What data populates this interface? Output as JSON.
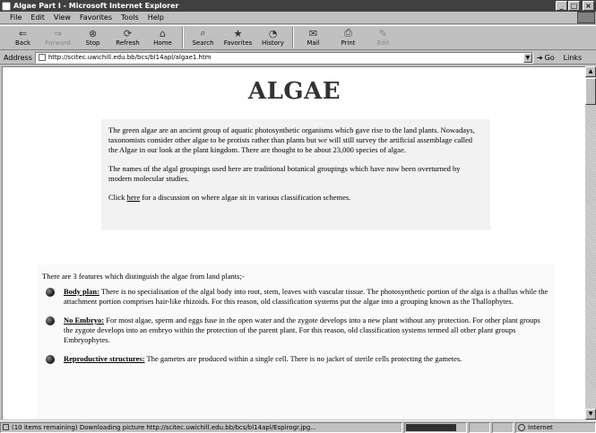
{
  "window": {
    "title": "Algae Part I - Microsoft Internet Explorer",
    "minimize": "_",
    "maximize": "□",
    "close": "×"
  },
  "menu": [
    "File",
    "Edit",
    "View",
    "Favorites",
    "Tools",
    "Help"
  ],
  "toolbar": [
    {
      "label": "Back",
      "icon": "back-arrow-icon",
      "glyph": "⇐"
    },
    {
      "label": "Forward",
      "icon": "forward-arrow-icon",
      "glyph": "⇒"
    },
    {
      "label": "Stop",
      "icon": "stop-icon",
      "glyph": "⊗"
    },
    {
      "label": "Refresh",
      "icon": "refresh-icon",
      "glyph": "⟳"
    },
    {
      "label": "Home",
      "icon": "home-icon",
      "glyph": "⌂"
    },
    {
      "label": "Search",
      "icon": "search-icon",
      "glyph": "⌕"
    },
    {
      "label": "Favorites",
      "icon": "favorites-icon",
      "glyph": "★"
    },
    {
      "label": "History",
      "icon": "history-icon",
      "glyph": "◔"
    },
    {
      "label": "Mail",
      "icon": "mail-icon",
      "glyph": "✉"
    },
    {
      "label": "Print",
      "icon": "print-icon",
      "glyph": "⎙"
    },
    {
      "label": "Edit",
      "icon": "edit-icon",
      "glyph": "✎"
    }
  ],
  "address": {
    "label": "Address",
    "url": "http://scitec.uwichill.edu.bb/bcs/bl14apl/algae1.htm",
    "go": "Go",
    "links": "Links"
  },
  "page": {
    "title": "ALGAE",
    "intro_p1": "The green algae are an ancient group of aquatic photosynthetic organisms which gave rise to the land plants. Nowadays, taxonomists consider other algae to be protists rather than plants but we will still survey the artificial assemblage called the Algae in our look at the plant kingdom. There are thought to be about 23,000 species of algae.",
    "intro_p2": "The names of the algal groupings used here are traditional botanical groupings which have now been overturned by modern molecular studies.",
    "click_prefix": "Click ",
    "click_link": "here",
    "click_suffix": " for a discussion on where algae sit in various classification schemes.",
    "features_intro": "There are 3 features which distinguish the algae from land plants;-",
    "features": [
      {
        "term": "Body plan:",
        "text": " There is no specialisation of the algal body into root, stem, leaves with vascular tissue. The photosynthetic portion of the alga is a thallus while the attachment portion comprises hair-like rhizoids. For this reason, old classification systems put the algae into a grouping known as the Thallophytes."
      },
      {
        "term": "No Embryo:",
        "text": " For most algae, sperm and eggs fuse in the open water and the zygote develops into a new plant without any protection. For other plant groups the zygote develops into an embryo within the protection of the parent plant. For this reason, old classification systems termed all other plant groups Embryophytes."
      },
      {
        "term": "Reproductive structures:",
        "text": " The gametes are produced within a single cell. There is no jacket of sterile cells protecting the gametes."
      }
    ]
  },
  "status": {
    "text": "(10 items remaining) Downloading picture http://scitec.uwichill.edu.bb/bcs/bl14apl/Espirogr.jpg...",
    "progress": 0.85,
    "zone": "Internet"
  }
}
